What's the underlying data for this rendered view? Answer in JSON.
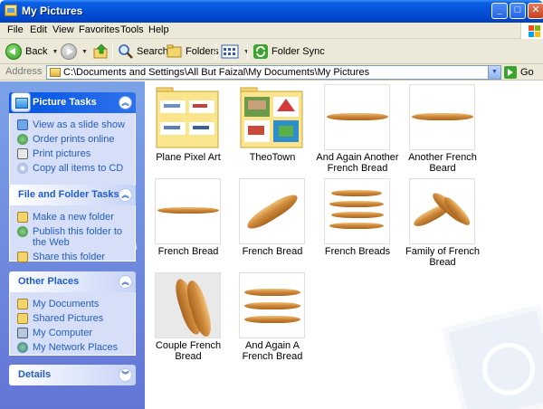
{
  "window": {
    "title": "My Pictures",
    "controls": {
      "minimize": "_",
      "maximize": "□",
      "close": "✕"
    }
  },
  "menu": [
    "File",
    "Edit",
    "View",
    "Favorites",
    "Tools",
    "Help"
  ],
  "toolbar": {
    "back_label": "Back",
    "search_label": "Search",
    "folders_label": "Folders",
    "folder_sync_label": "Folder Sync"
  },
  "address": {
    "label": "Address",
    "path": "C:\\Documents and Settings\\All But Faizal\\My Documents\\My Pictures",
    "go_label": "Go"
  },
  "sidebar": {
    "picture_tasks": {
      "title": "Picture Tasks",
      "items": [
        "View as a slide show",
        "Order prints online",
        "Print pictures",
        "Copy all items to CD"
      ]
    },
    "file_folder_tasks": {
      "title": "File and Folder Tasks",
      "items": [
        "Make a new folder",
        "Publish this folder to the Web",
        "Share this folder"
      ]
    },
    "other_places": {
      "title": "Other Places",
      "items": [
        "My Documents",
        "Shared Pictures",
        "My Computer",
        "My Network Places"
      ]
    },
    "details": {
      "title": "Details"
    }
  },
  "files": [
    {
      "name": "Plane Pixel Art",
      "kind": "folder"
    },
    {
      "name": "TheoTown",
      "kind": "folder"
    },
    {
      "name": "And Again Another French Bread",
      "kind": "image"
    },
    {
      "name": "Another French Beard",
      "kind": "image"
    },
    {
      "name": "French Bread",
      "kind": "image"
    },
    {
      "name": "French Bread",
      "kind": "image"
    },
    {
      "name": "French Breads",
      "kind": "image"
    },
    {
      "name": "Family of French Bread",
      "kind": "image"
    },
    {
      "name": "Couple French Bread",
      "kind": "image"
    },
    {
      "name": "And Again A French Bread",
      "kind": "image"
    }
  ],
  "colors": {
    "titlebar": "#0552d8",
    "sidebar_bg": "#7ba2e7",
    "task_link": "#215dc6",
    "bread": "#d08a3a"
  }
}
